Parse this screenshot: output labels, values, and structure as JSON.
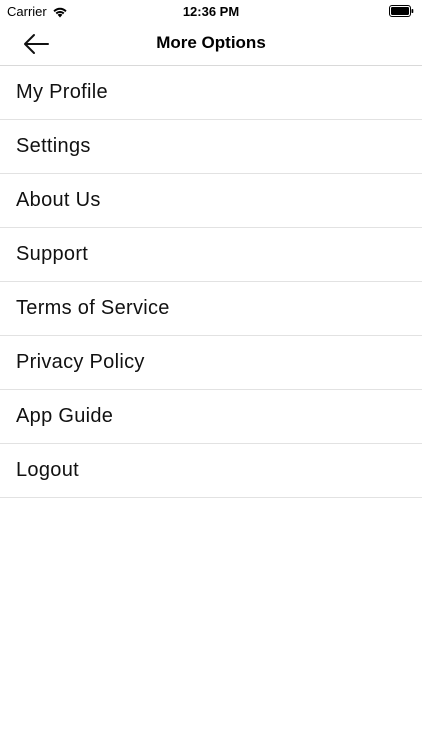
{
  "status_bar": {
    "carrier": "Carrier",
    "time": "12:36 PM",
    "icons": [
      "wifi-icon",
      "battery-icon"
    ]
  },
  "nav": {
    "title": "More Options",
    "back_icon": "arrow-left-icon"
  },
  "menu": {
    "items": [
      {
        "label": "My Profile"
      },
      {
        "label": "Settings"
      },
      {
        "label": "About Us"
      },
      {
        "label": "Support"
      },
      {
        "label": "Terms of Service"
      },
      {
        "label": "Privacy Policy"
      },
      {
        "label": "App Guide"
      },
      {
        "label": "Logout"
      }
    ]
  },
  "colors": {
    "background": "#ffffff",
    "text": "#111111",
    "divider": "#e2e2e2"
  }
}
